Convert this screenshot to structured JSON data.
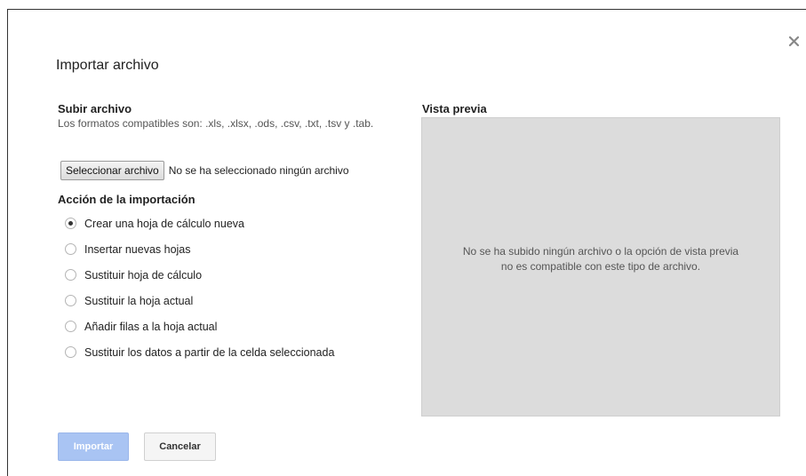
{
  "dialog": {
    "title": "Importar archivo",
    "close_icon": "close-icon"
  },
  "upload": {
    "heading": "Subir archivo",
    "description": "Los formatos compatibles son: .xls, .xlsx, .ods, .csv, .txt, .tsv y .tab.",
    "select_button": "Seleccionar archivo",
    "file_status": "No se ha seleccionado ningún archivo"
  },
  "import_action": {
    "heading": "Acción de la importación",
    "selected_index": 0,
    "options": [
      {
        "label": "Crear una hoja de cálculo nueva"
      },
      {
        "label": "Insertar nuevas hojas"
      },
      {
        "label": "Sustituir hoja de cálculo"
      },
      {
        "label": "Sustituir la hoja actual"
      },
      {
        "label": "Añadir filas a la hoja actual"
      },
      {
        "label": "Sustituir los datos a partir de la celda seleccionada"
      }
    ]
  },
  "preview": {
    "heading": "Vista previa",
    "message_line1": "No se ha subido ningún archivo o la opción de vista previa",
    "message_line2": "no es compatible con este tipo de archivo."
  },
  "footer": {
    "import_label": "Importar",
    "cancel_label": "Cancelar"
  },
  "colors": {
    "import_button_disabled": "#a9c4f3",
    "preview_background": "#dcdcdc"
  }
}
